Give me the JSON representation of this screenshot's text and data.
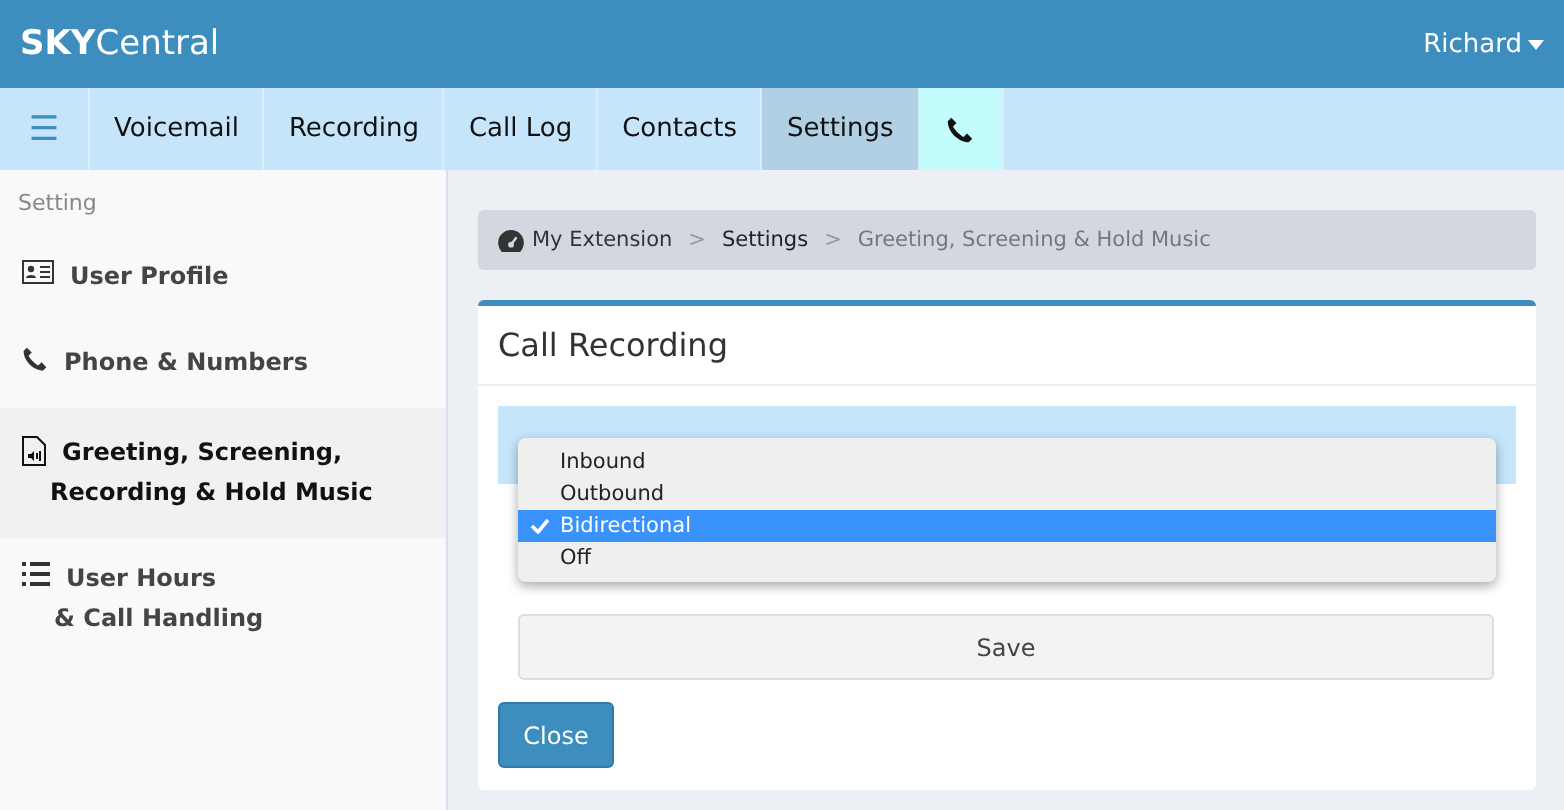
{
  "header": {
    "brand_bold": "SKY",
    "brand_rest": "Central",
    "user": "Richard"
  },
  "nav": {
    "menu_icon": "☰",
    "tabs": [
      {
        "label": "Voicemail",
        "selected": false,
        "kind": "text"
      },
      {
        "label": "Recording",
        "selected": false,
        "kind": "text"
      },
      {
        "label": "Call Log",
        "selected": false,
        "kind": "text"
      },
      {
        "label": "Contacts",
        "selected": false,
        "kind": "text"
      },
      {
        "label": "Settings",
        "selected": true,
        "kind": "text"
      },
      {
        "selected": false,
        "kind": "phone"
      }
    ]
  },
  "sidebar": {
    "heading": "Setting",
    "items": [
      {
        "kind": "card",
        "lines": [
          "User Profile"
        ],
        "selected": false
      },
      {
        "kind": "phone",
        "lines": [
          "Phone & Numbers"
        ],
        "selected": false
      },
      {
        "kind": "file",
        "lines": [
          "Greeting, Screening,",
          "Recording & Hold Music"
        ],
        "selected": true
      },
      {
        "kind": "list",
        "lines": [
          "User Hours",
          "& Call Handling"
        ],
        "selected": false
      }
    ]
  },
  "breadcrumb": [
    {
      "label": "My Extension",
      "kind": "home"
    },
    {
      "label": "Settings",
      "kind": "link"
    },
    {
      "label": "Greeting, Screening & Hold Music",
      "kind": "current"
    }
  ],
  "breadcrumb_separator": ">",
  "card": {
    "title": "Call Recording",
    "dropdown": [
      {
        "label": "Inbound",
        "selected": false
      },
      {
        "label": "Outbound",
        "selected": false
      },
      {
        "label": "Bidirectional",
        "selected": true
      },
      {
        "label": "Off",
        "selected": false
      }
    ],
    "save": "Save",
    "close": "Close"
  }
}
